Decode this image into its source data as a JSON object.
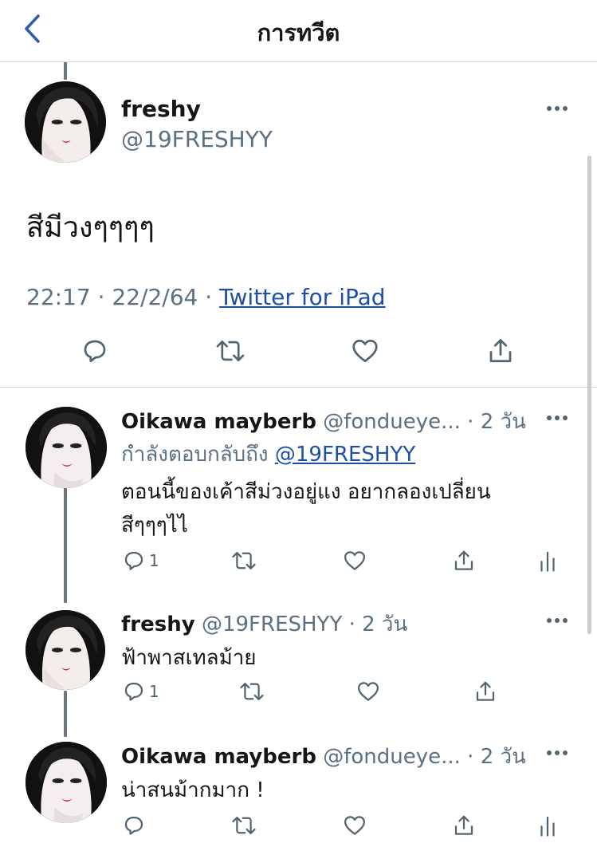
{
  "header": {
    "title": "การทวีต"
  },
  "main_tweet": {
    "name": "freshy",
    "handle": "@19FRESHYY",
    "text": "สีมีวงๆๆๆๆ",
    "time": "22:17 · 22/2/64 · ",
    "source": "Twitter for iPad"
  },
  "replies": [
    {
      "name": "Oikawa mayberb",
      "handle": "@fondueye...",
      "time": " · 2 วัน",
      "replying_prefix": "กำลังตอบกลับถึง ",
      "replying_to": "@19FRESHYY",
      "text_line1": "ตอนนี้ของเค้าสีม่วงอยู่แง อยากลองเปลี่ยน",
      "text_line2": "สีๆๆๆไไ",
      "reply_count": "1"
    },
    {
      "name": "freshy",
      "handle": "@19FRESHYY",
      "time": " · 2 วัน",
      "text_line1": "ฟ้าพาสเทลม้าย",
      "reply_count": "1"
    },
    {
      "name": "Oikawa mayberb",
      "handle": "@fondueye...",
      "time": " · 2 วัน",
      "text_line1": "น่าสนม้ากมาก !"
    }
  ],
  "colors": {
    "accent": "#1d4fa7",
    "secondary_text": "#5b7083",
    "divider": "#cfd6db"
  }
}
